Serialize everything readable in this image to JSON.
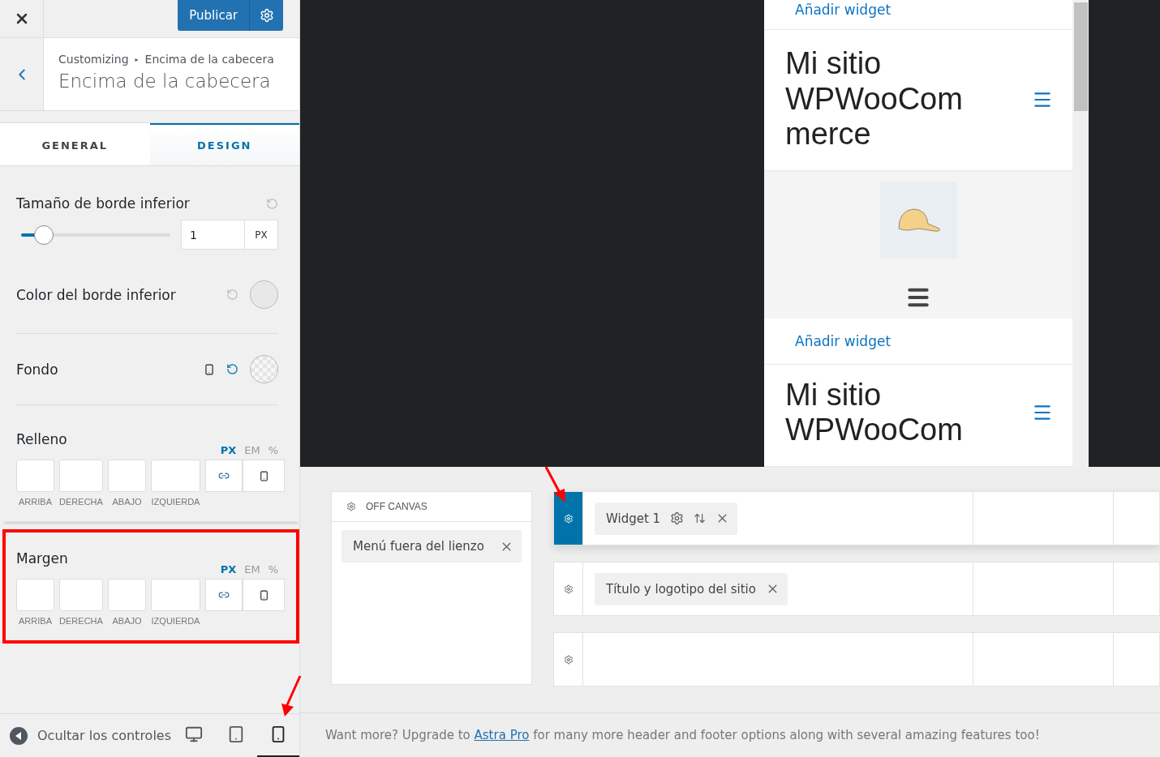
{
  "topbar": {
    "publish_button": "Publicar"
  },
  "section_header": {
    "path": [
      "Customizing",
      "Encima de la cabecera"
    ],
    "separator": "▸",
    "title": "Encima de la cabecera"
  },
  "tabs": [
    {
      "label": "GENERAL",
      "selected": false
    },
    {
      "label": "DESIGN",
      "selected": true
    }
  ],
  "controls": [
    {
      "kind": "slider",
      "label": "Tamaño de borde inferior",
      "level": 0.15,
      "value": "1",
      "unit": "PX"
    },
    {
      "kind": "color",
      "label": "Color del borde inferior"
    },
    {
      "kind": "background",
      "label": "Fondo"
    },
    {
      "kind": "spacing",
      "label": "Relleno",
      "highlighted": false,
      "units": [
        {
          "label": "PX",
          "selected": true
        },
        {
          "label": "EM",
          "selected": false
        },
        {
          "label": "%",
          "selected": false
        }
      ],
      "sides": [
        "ARRIBA",
        "DERECHA",
        "ABAJO",
        "IZQUIERDA"
      ]
    },
    {
      "kind": "spacing",
      "label": "Margen",
      "highlighted": true,
      "units": [
        {
          "label": "PX",
          "selected": true
        },
        {
          "label": "EM",
          "selected": false
        },
        {
          "label": "%",
          "selected": false
        }
      ],
      "sides": [
        "ARRIBA",
        "DERECHA",
        "ABAJO",
        "IZQUIERDA"
      ]
    }
  ],
  "sidebar_footer": {
    "hide_controls": "Ocultar los controles",
    "devices": [
      {
        "kind": "desktop",
        "selected": false
      },
      {
        "kind": "tablet",
        "selected": false
      },
      {
        "kind": "mobile",
        "selected": true
      }
    ]
  },
  "preview": {
    "sections": [
      {
        "kind": "widget",
        "link": "Añadir widget"
      },
      {
        "kind": "title",
        "text": "Mi sitio WPWooCommerce"
      },
      {
        "kind": "image"
      },
      {
        "kind": "widget",
        "link": "Añadir widget"
      },
      {
        "kind": "title",
        "text": "Mi sitio WPWooCom"
      }
    ]
  },
  "builder": {
    "off_canvas": {
      "title": "OFF CANVAS",
      "items": [
        "Menú fuera del lienzo"
      ]
    },
    "rows": [
      {
        "selected": true,
        "items": [
          {
            "kind": "widget",
            "label": "Widget 1"
          }
        ]
      },
      {
        "selected": false,
        "items": [
          {
            "kind": "element",
            "label": "Título y logotipo del sitio"
          }
        ]
      },
      {
        "selected": false,
        "items": []
      }
    ]
  },
  "upgrade_note": {
    "before": "Want more? Upgrade to",
    "link": "Astra Pro",
    "after": "for many more header and footer options along with several amazing features too!"
  }
}
